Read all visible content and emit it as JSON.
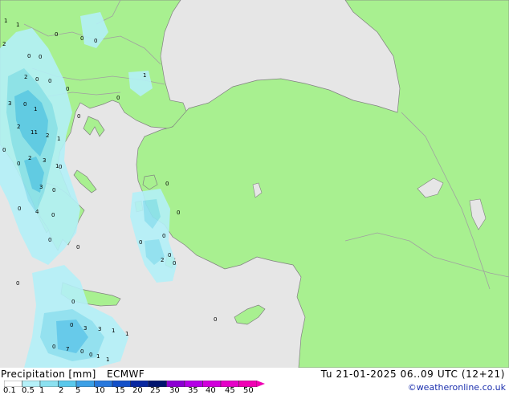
{
  "footer": {
    "title": "Precipitation [mm]",
    "model": "ECMWF",
    "valid_time": "Tu 21-01-2025 06..09 UTC (12+21)",
    "credit": "©weatheronline.co.uk"
  },
  "legend": {
    "ticks": [
      "0.1",
      "0.5",
      "1",
      "2",
      "5",
      "10",
      "15",
      "20",
      "25",
      "30",
      "35",
      "40",
      "45",
      "50"
    ],
    "colors": [
      "#ffffff",
      "#b4f0f8",
      "#8ce1f0",
      "#5ac8eb",
      "#3ca0e6",
      "#2878dc",
      "#1450c8",
      "#0a28a0",
      "#00146e",
      "#8c00d2",
      "#b400e6",
      "#d200dc",
      "#e600c8",
      "#f000b4"
    ]
  },
  "map": {
    "colors": {
      "sea": "#e6e6e6",
      "land": "#a8f090",
      "border": "#a0a0a0",
      "coast": "#808080"
    },
    "labels": [
      "1",
      "1",
      "0",
      "0",
      "0",
      "0",
      "2",
      "0",
      "0",
      "2",
      "0",
      "0",
      "1",
      "0",
      "0",
      "3",
      "0",
      "1",
      "2",
      "11",
      "2",
      "1",
      "0",
      "2",
      "0",
      "0",
      "3",
      "1",
      "3",
      "0",
      "4",
      "0",
      "0",
      "0",
      "0",
      "0",
      "0",
      "0",
      "0",
      "0",
      "0",
      "0",
      "2",
      "0",
      "0",
      "0",
      "3",
      "3",
      "1",
      "1",
      "0",
      "7",
      "0",
      "1",
      "1",
      "0"
    ]
  }
}
